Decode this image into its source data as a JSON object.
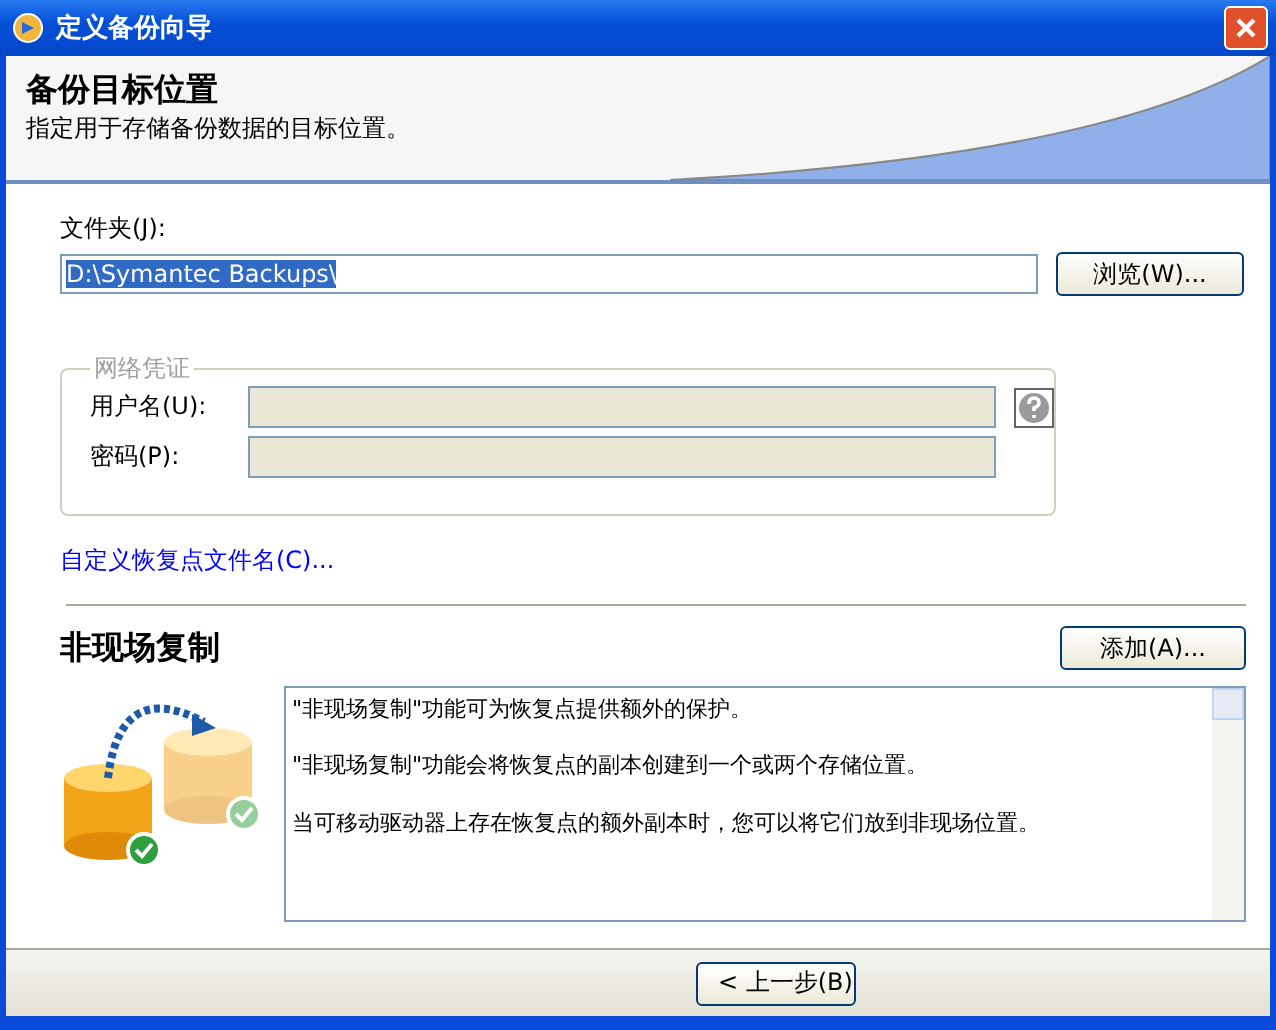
{
  "window": {
    "title": "定义备份向导"
  },
  "header": {
    "title": "备份目标位置",
    "subtitle": "指定用于存储备份数据的目标位置。"
  },
  "folder": {
    "label": "文件夹(J):",
    "value": "D:\\Symantec Backups\\",
    "selected": true,
    "browse_button": "浏览(W)..."
  },
  "credentials": {
    "legend": "网络凭证",
    "disabled": true,
    "fields": [
      {
        "label": "用户名(U):",
        "help": true
      },
      {
        "label": "密码(P):",
        "help": false
      }
    ]
  },
  "custom_name_link": "自定义恢复点文件名(C)...",
  "offsite": {
    "title": "非现场复制",
    "add_button": "添加(A)...",
    "paragraphs": [
      "\"非现场复制\"功能可为恢复点提供额外的保护。",
      "\"非现场复制\"功能会将恢复点的副本创建到一个或两个存储位置。",
      "当可移动驱动器上存在恢复点的额外副本时，您可以将它们放到非现场位置。"
    ]
  },
  "footer": {
    "buttons": [
      "< 上一步(B)"
    ]
  }
}
